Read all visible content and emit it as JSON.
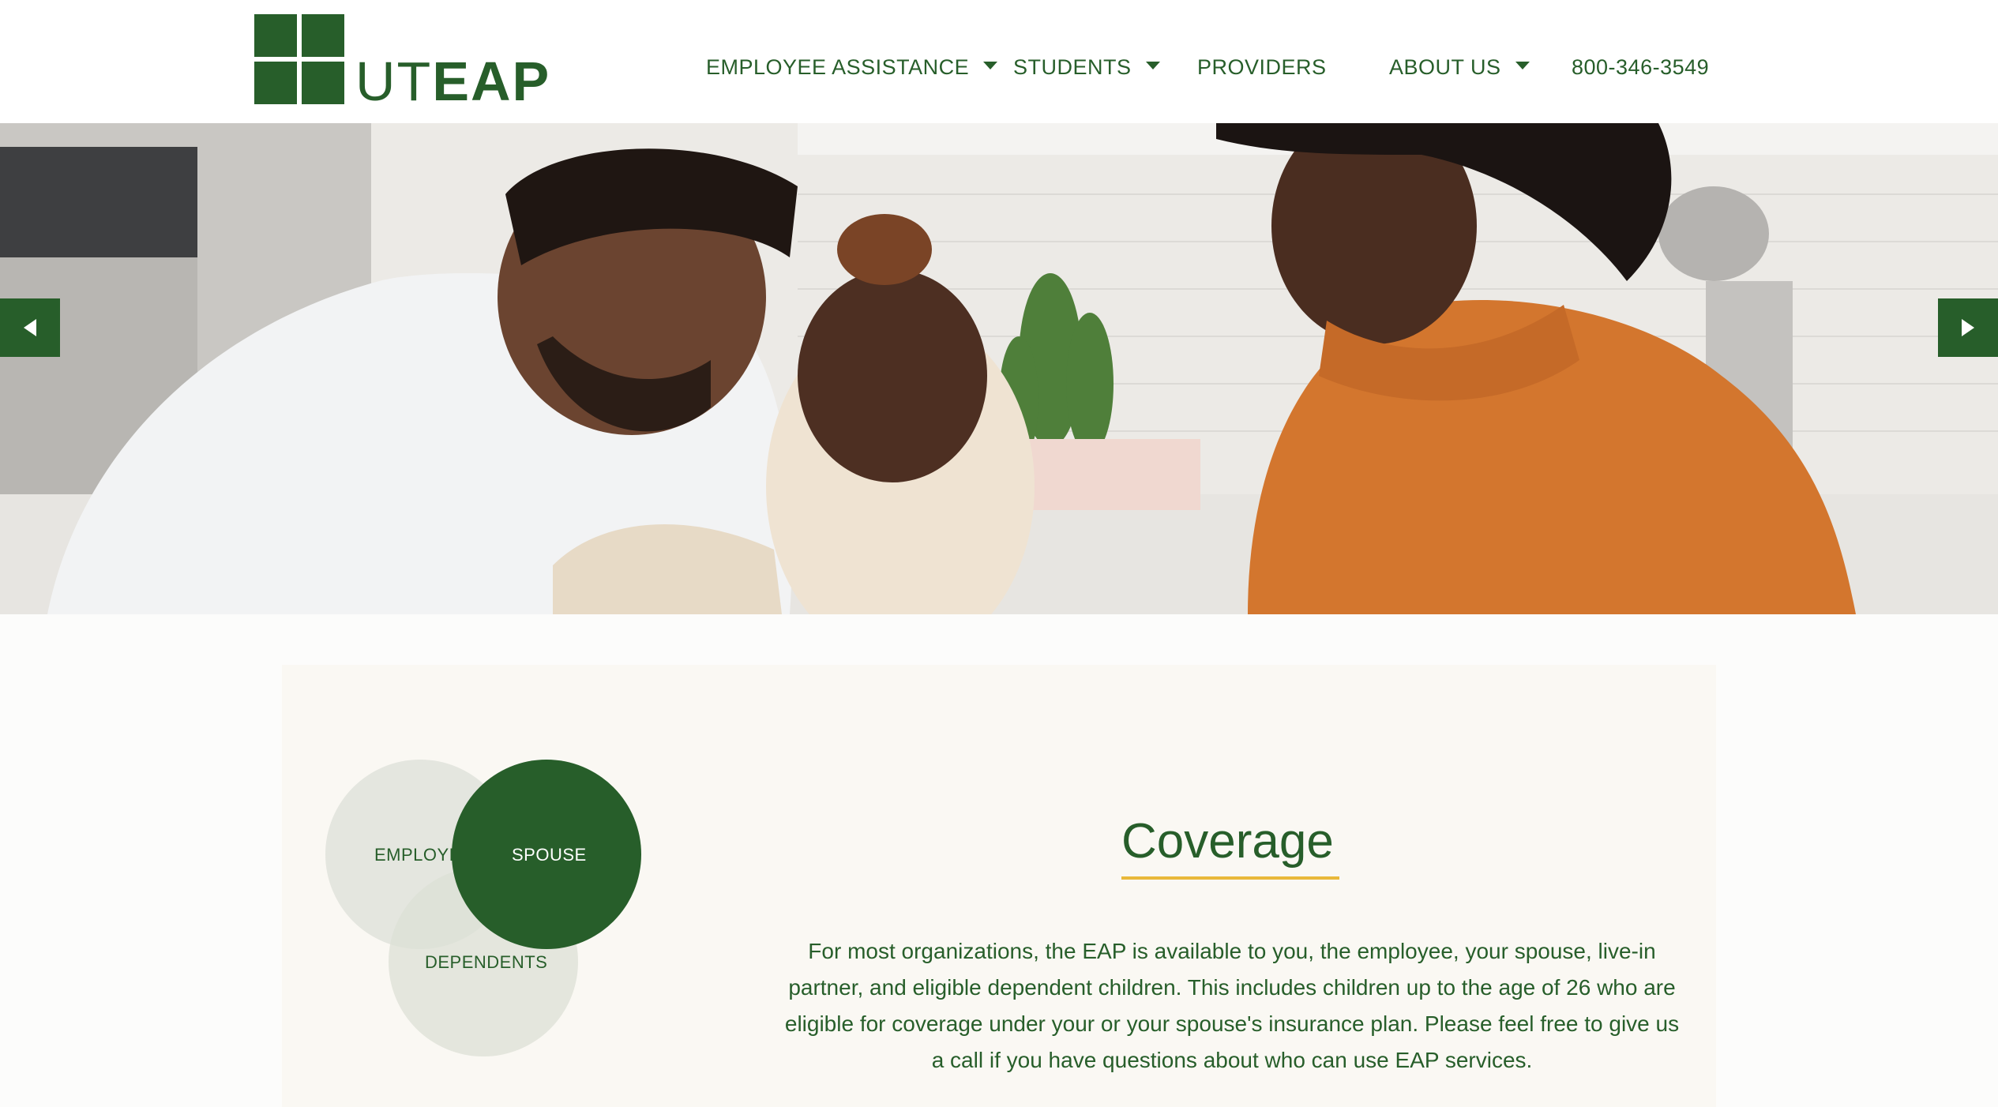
{
  "brand": {
    "logo_ut": "UT",
    "logo_eap": "EAP",
    "primary_color": "#275e2a",
    "accent_color": "#e9b83a"
  },
  "nav": {
    "items": [
      {
        "label": "EMPLOYEE ASSISTANCE",
        "has_dropdown": true
      },
      {
        "label": "STUDENTS",
        "has_dropdown": true
      },
      {
        "label": "PROVIDERS",
        "has_dropdown": false
      },
      {
        "label": "ABOUT US",
        "has_dropdown": true
      }
    ],
    "phone": "800-346-3549"
  },
  "hero": {
    "prev_icon": "chevron-left-icon",
    "next_icon": "chevron-right-icon"
  },
  "coverage": {
    "venn": {
      "employee": "EMPLOYEE",
      "spouse": "SPOUSE",
      "dependents": "DEPENDENTS"
    },
    "title": "Coverage",
    "body": "For most organizations, the EAP is available to you, the employee, your spouse, live-in partner, and eligible dependent children. This includes children up to the age of 26 who are eligible for coverage under your or your spouse's insurance plan. Please feel free to give us a call if you have questions about who can use EAP services."
  }
}
